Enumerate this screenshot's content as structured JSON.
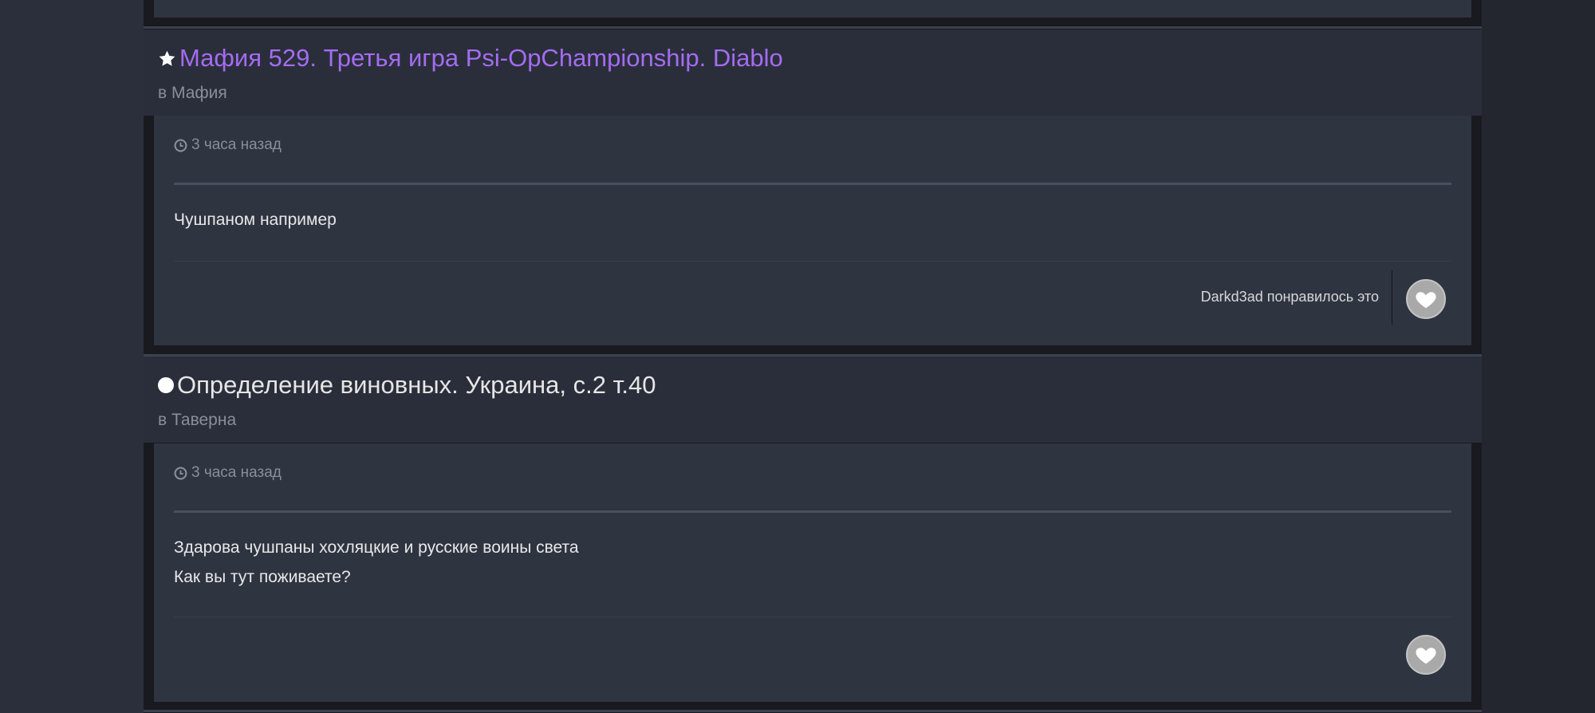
{
  "results": [
    {
      "title": "Мафия 529. Третья игра Psi-OpChampionship. Diablo",
      "title_color": "#a46cf2",
      "marker_icon": "star-icon",
      "forum_prefix": "в",
      "forum_name": "Мафия",
      "timestamp": "3 часа назад",
      "content_lines": [
        "Чушпаном например"
      ],
      "reaction_text": "Darkd3ad понравилось это"
    },
    {
      "title": "Определение виновных. Украина, с.2 т.40",
      "title_color": "#e6e6e6",
      "marker_icon": "circle-icon",
      "forum_prefix": "в",
      "forum_name": "Таверна",
      "timestamp": "3 часа назад",
      "content_lines": [
        "Здарова чушпаны хохляцкие и русские воины света",
        "Как вы тут поживаете?"
      ],
      "reaction_text": ""
    }
  ],
  "icons": {
    "clock": "clock-icon",
    "like": "heart-icon"
  }
}
